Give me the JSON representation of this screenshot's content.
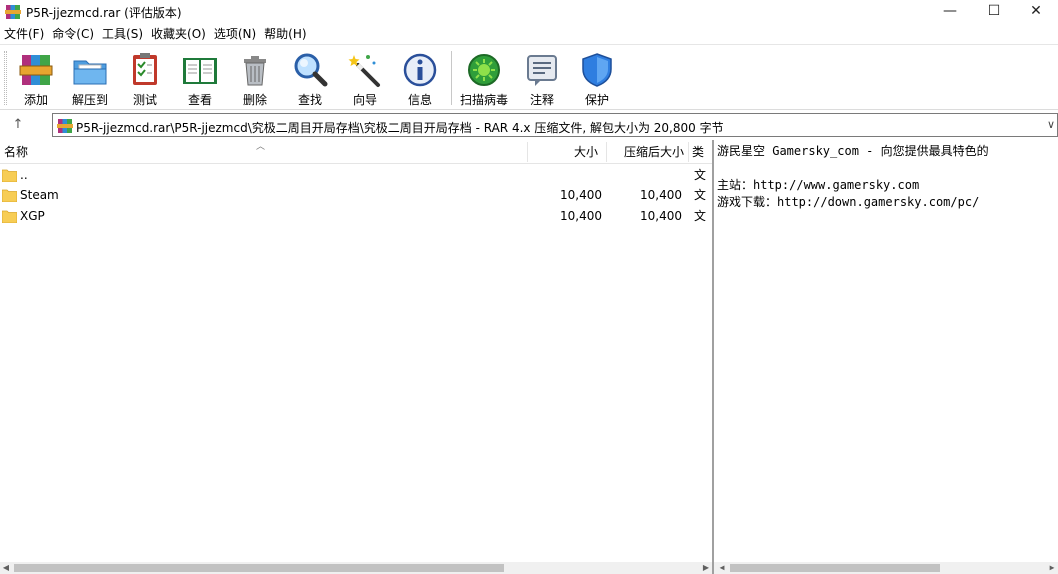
{
  "window": {
    "title": "P5R-jjezmcd.rar (评估版本)",
    "minimize_glyph": "—",
    "maximize_glyph": "☐",
    "close_glyph": "✕"
  },
  "menu": [
    {
      "label": "文件(F)"
    },
    {
      "label": "命令(C)"
    },
    {
      "label": "工具(S)"
    },
    {
      "label": "收藏夹(O)"
    },
    {
      "label": "选项(N)"
    },
    {
      "label": "帮助(H)"
    }
  ],
  "toolbar": [
    {
      "label": "添加",
      "icon": "add-archive-icon"
    },
    {
      "label": "解压到",
      "icon": "extract-folder-icon"
    },
    {
      "label": "测试",
      "icon": "test-clipboard-icon"
    },
    {
      "label": "查看",
      "icon": "view-book-icon"
    },
    {
      "label": "删除",
      "icon": "trash-icon"
    },
    {
      "label": "查找",
      "icon": "magnifier-icon"
    },
    {
      "label": "向导",
      "icon": "wizard-wand-icon"
    },
    {
      "label": "信息",
      "icon": "info-icon"
    },
    {
      "label": "扫描病毒",
      "icon": "virus-scan-icon"
    },
    {
      "label": "注释",
      "icon": "comment-note-icon"
    },
    {
      "label": "保护",
      "icon": "shield-icon"
    }
  ],
  "address": {
    "up_glyph": "↑",
    "path": "P5R-jjezmcd.rar\\P5R-jjezmcd\\究极二周目开局存档\\究极二周目开局存档 - RAR 4.x 压缩文件, 解包大小为 20,800 字节",
    "dropdown_glyph": "∨"
  },
  "columns": {
    "name": "名称",
    "size": "大小",
    "packed": "压缩后大小",
    "type": "类"
  },
  "files": [
    {
      "name": "..",
      "size": "",
      "packed": "",
      "type": "文"
    },
    {
      "name": "Steam",
      "size": "10,400",
      "packed": "10,400",
      "type": "文"
    },
    {
      "name": "XGP",
      "size": "10,400",
      "packed": "10,400",
      "type": "文"
    }
  ],
  "comment": [
    "游民星空 Gamersky_com - 向您提供最具特色的",
    "",
    "主站：http://www.gamersky.com",
    "游戏下载：http://down.gamersky.com/pc/"
  ],
  "colors": {
    "folder": "#f7cd55",
    "accent": "#1f6fd1"
  }
}
